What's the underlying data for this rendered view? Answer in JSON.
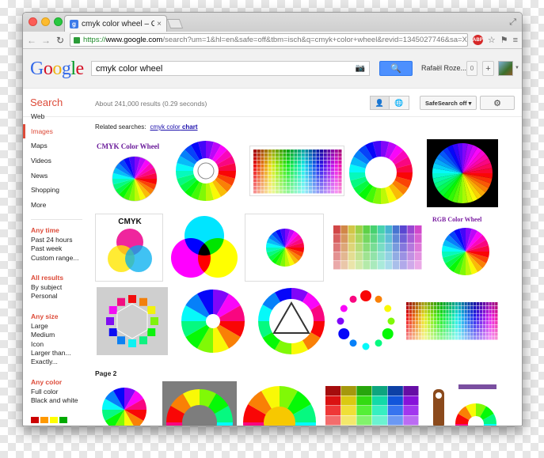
{
  "browser": {
    "tab_title": "cmyk color wheel – Google S",
    "tab_favicon_letter": "g",
    "url_scheme": "https://",
    "url_host": "www.google.com",
    "url_rest": "/search?um=1&hl=en&safe=off&tbm=isch&q=cmyk+color+wheel&revid=1345027746&sa=X&ei...",
    "adblock_label": "ABP"
  },
  "google": {
    "logo_letters": [
      "G",
      "o",
      "o",
      "g",
      "l",
      "e"
    ],
    "query": "cmyk color wheel",
    "username": "Rafaël Roze...",
    "notification_count": "0",
    "plus_label": "+",
    "search_label": "Search",
    "stats": "About 241,000 results (0.29 seconds)",
    "safesearch": "SafeSearch off ▾"
  },
  "leftnav": {
    "items": [
      "Web",
      "Images",
      "Maps",
      "Videos",
      "News",
      "Shopping",
      "More"
    ],
    "active_index": 1
  },
  "filters": [
    {
      "heading": "Any time",
      "options": [
        "Past 24 hours",
        "Past week",
        "Custom range..."
      ]
    },
    {
      "heading": "All results",
      "options": [
        "By subject",
        "Personal"
      ]
    },
    {
      "heading": "Any size",
      "options": [
        "Large",
        "Medium",
        "Icon",
        "Larger than...",
        "Exactly..."
      ]
    },
    {
      "heading": "Any color",
      "options": [
        "Full color",
        "Black and white"
      ]
    }
  ],
  "color_swatches": [
    "#cc0000",
    "#ff9900",
    "#ffff00",
    "#00aa00"
  ],
  "related": {
    "prefix": "Related searches:",
    "link_plain": "cmyk color",
    "link_bold": "chart"
  },
  "page2_label": "Page 2",
  "thumb_texts": {
    "cmyk_wheel_label": "CMYK Color Wheel",
    "cmyk_venn_title": "CMYK",
    "rgb_wheel_label": "RGB Color Wheel"
  }
}
